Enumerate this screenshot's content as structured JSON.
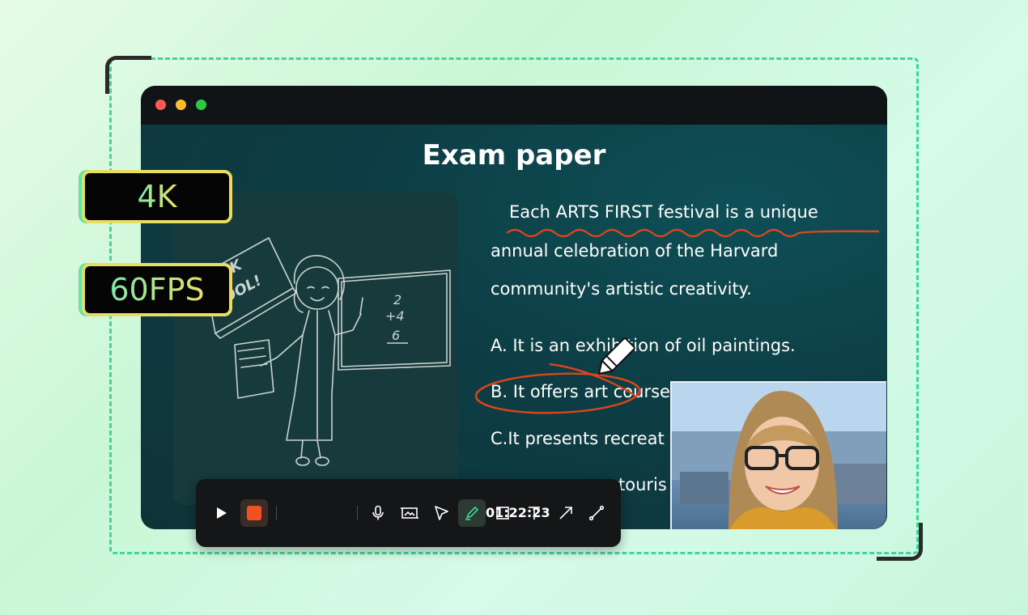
{
  "badges": {
    "resolution": "4K",
    "frame_rate": "60FPS"
  },
  "slide": {
    "title": "Exam paper",
    "blackboard_numbers": {
      "top": "2",
      "middle": "+4",
      "bottom": "6"
    },
    "sign_text": [
      "CK",
      "OOL!"
    ],
    "passage_lines": [
      "Each ARTS FIRST festival is a unique",
      "annual celebration of the Harvard",
      "community's artistic creativity."
    ],
    "options": [
      "A. It is an exhibition of oil paintings.",
      "B. It offers art courses",
      "C.It presents recreat",
      "touris"
    ]
  },
  "toolbar": {
    "timer": "01:22:23",
    "tools": [
      "play-icon",
      "record-icon",
      "microphone-icon",
      "screen-capture-icon",
      "cursor-icon",
      "pen-icon",
      "rectangle-icon",
      "text-icon",
      "arrow-icon",
      "line-icon"
    ],
    "active_tool": "pen-icon"
  },
  "colors": {
    "accent_green": "#3fd69a",
    "record_red": "#f0531e",
    "annotation_orange": "#d9461c",
    "badge_gradient_start": "#7ee9a7",
    "badge_gradient_end": "#e9e06a"
  }
}
